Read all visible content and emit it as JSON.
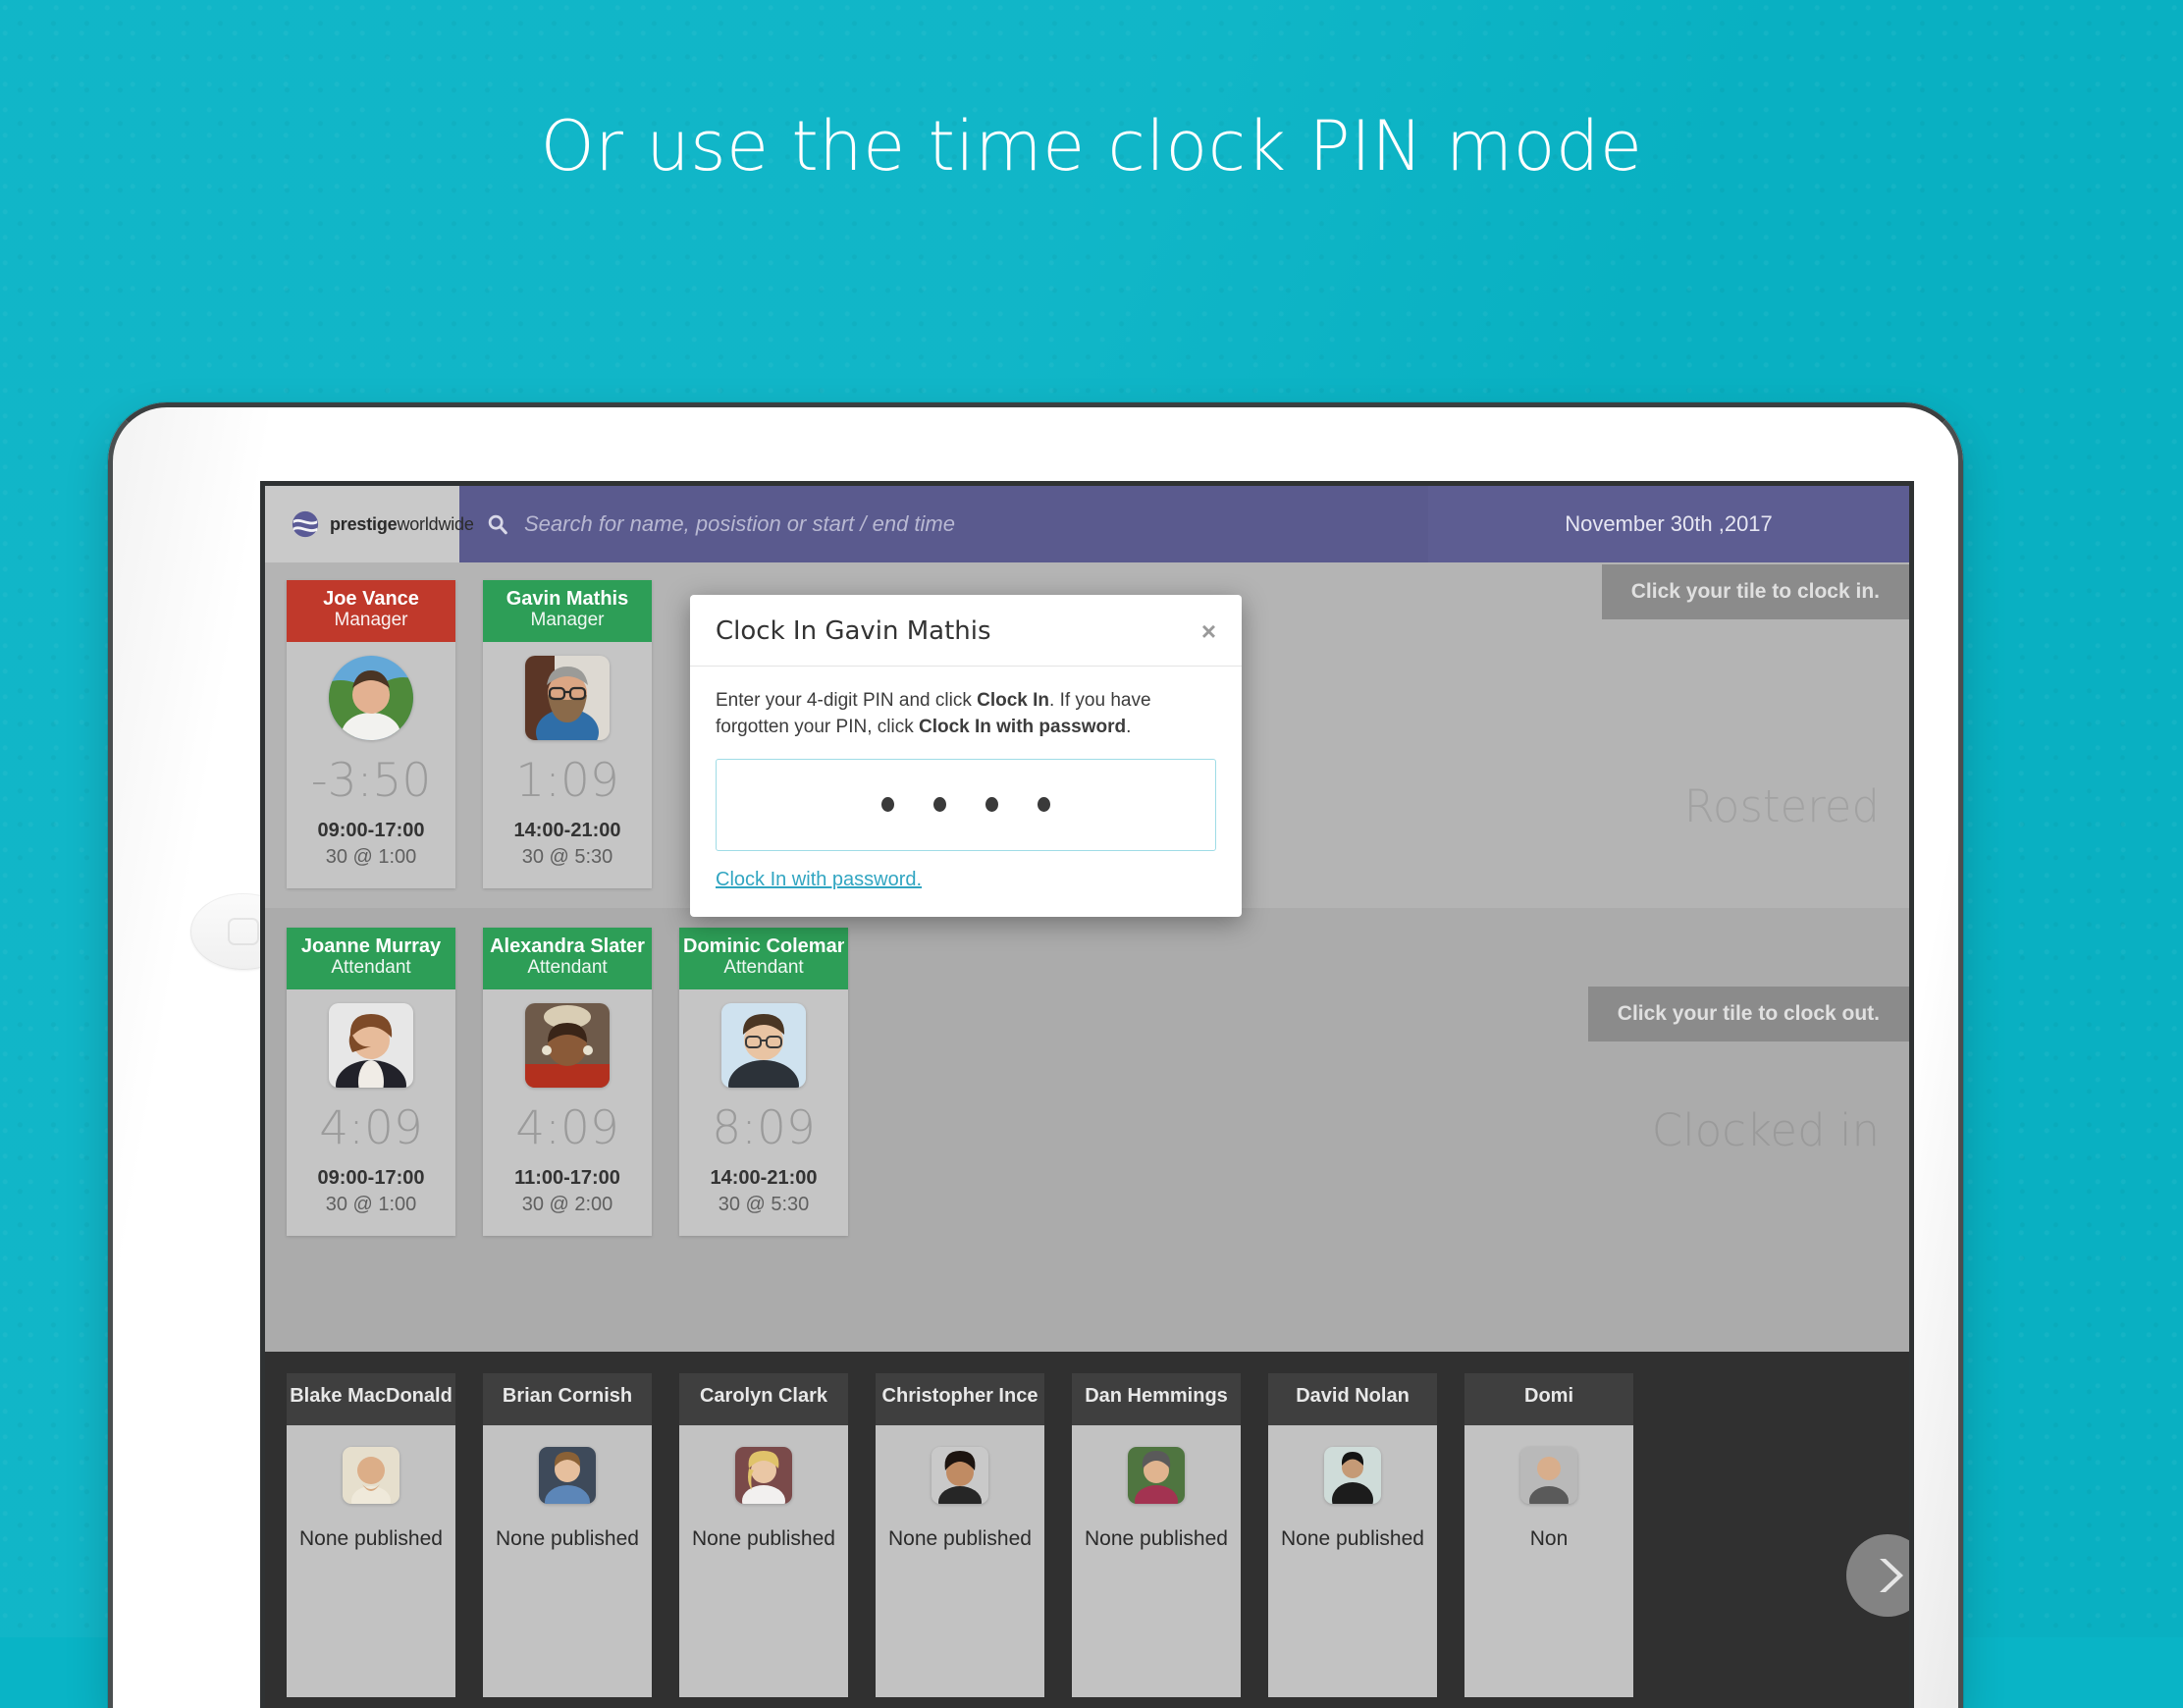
{
  "headline": "Or use the time clock PIN mode",
  "colors": {
    "background_teal": "#09b4c6",
    "topbar_purple": "#5a5a8e",
    "header_red": "#c0392b",
    "header_green": "#2d9e57",
    "link_blue": "#31a5c1"
  },
  "topbar": {
    "logo_bold": "prestige",
    "logo_light": "worldwide",
    "search_placeholder": "Search for name, posistion or start / end time",
    "date": "November 30th ,2017"
  },
  "sections": {
    "rostered_label": "Rostered",
    "clockedin_label": "Clocked in",
    "hint_clock_in": "Click your tile to clock in.",
    "hint_clock_out": "Click your tile to clock out."
  },
  "rostered_tiles": [
    {
      "name": "Joe Vance",
      "role": "Manager",
      "header": "red",
      "time": "-3:50",
      "shift": "09:00-17:00",
      "break": "30 @ 1:00"
    },
    {
      "name": "Gavin Mathis",
      "role": "Manager",
      "header": "green",
      "time": "1:09",
      "shift": "14:00-21:00",
      "break": "30 @ 5:30"
    }
  ],
  "clockedin_tiles": [
    {
      "name": "Joanne Murray",
      "role": "Attendant",
      "header": "green",
      "time": "4:09",
      "shift": "09:00-17:00",
      "break": "30 @ 1:00"
    },
    {
      "name": "Alexandra Slater",
      "role": "Attendant",
      "header": "green",
      "time": "4:09",
      "shift": "11:00-17:00",
      "break": "30 @ 2:00"
    },
    {
      "name": "Dominic Coleman",
      "role": "Attendant",
      "header": "green",
      "time": "8:09",
      "shift": "14:00-21:00",
      "break": "30 @ 5:30"
    }
  ],
  "bottom_cards": [
    {
      "name": "Blake MacDonald",
      "status": "None published"
    },
    {
      "name": "Brian Cornish",
      "status": "None published"
    },
    {
      "name": "Carolyn Clark",
      "status": "None published"
    },
    {
      "name": "Christopher Ince",
      "status": "None published"
    },
    {
      "name": "Dan Hemmings",
      "status": "None published"
    },
    {
      "name": "David Nolan",
      "status": "None published"
    },
    {
      "name": "Domi",
      "status": "Non"
    }
  ],
  "modal": {
    "title": "Clock In Gavin Mathis",
    "close": "×",
    "body_part1": "Enter your 4-digit PIN and click ",
    "body_bold1": "Clock In",
    "body_part2": ". If you have forgotten your PIN, click ",
    "body_bold2": "Clock In with password",
    "body_part3": ".",
    "pin_dots": 4,
    "link": "Clock In with password."
  }
}
